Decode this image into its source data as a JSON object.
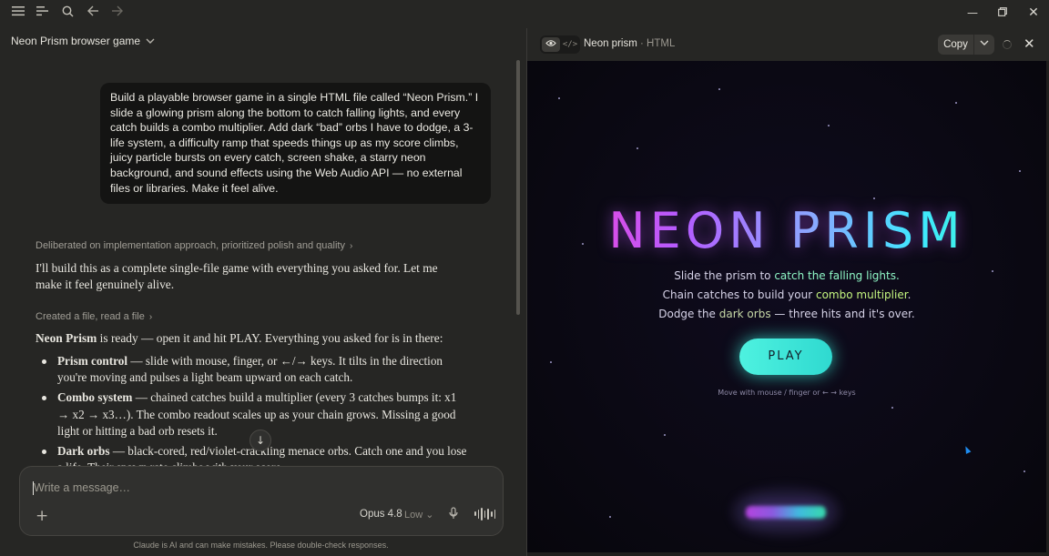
{
  "app": {
    "conversation_title": "Neon Prism browser game",
    "toolbar_icons": [
      "menu-icon",
      "sidebar-icon",
      "search-icon",
      "back-arrow-icon",
      "forward-arrow-icon"
    ]
  },
  "chat": {
    "user_message": "Build a playable browser game in a single HTML file called “Neon Prism.” I slide a glowing prism along the bottom to catch falling lights, and every catch builds a combo multiplier. Add dark “bad” orbs I have to dodge, a 3-life system, a difficulty ramp that speeds things up as my score climbs, juicy particle bursts on every catch, screen shake, a starry neon background, and sound effects using the Web Audio API — no external files or libraries. Make it feel alive.",
    "thinking_summary": "Deliberated on implementation approach, prioritized polish and quality",
    "intro": "I'll build this as a complete single-file game with everything you asked for. Let me make it feel genuinely alive.",
    "tool_summary": "Created a file, read a file",
    "ready_bold": "Neon Prism",
    "ready_rest": " is ready — open it and hit PLAY. Everything you asked for is in there:",
    "bullets": [
      {
        "title": "Prism control",
        "text": " — slide with mouse, finger, or ←/→ keys. It tilts in the direction you're moving and pulses a light beam upward on each catch."
      },
      {
        "title": "Combo system",
        "text": " — chained catches build a multiplier (every 3 catches bumps it: x1 → x2 → x3…). The combo readout scales up as your chain grows. Missing a good light or hitting a bad orb resets it."
      },
      {
        "title": "Dark orbs",
        "text": " — black-cored, red/violet-crackling menace orbs. Catch one and you lose a life. Their spawn rate climbs with your score."
      }
    ]
  },
  "composer": {
    "placeholder": "Write a message…",
    "model": "Opus 4.8",
    "effort": "Low",
    "disclaimer": "Claude is AI and can make mistakes. Please double-check responses."
  },
  "artifact": {
    "title": "Neon prism",
    "type_label": "· HTML",
    "copy_label": "Copy",
    "game": {
      "logo": "NEON PRISM",
      "line1_pre": "Slide the prism to ",
      "line1_hl": "catch the falling lights.",
      "line2_pre": "Chain catches to build your ",
      "line2_hl": "combo multiplier",
      "line2_post": ".",
      "line3_pre": "Dodge the ",
      "line3_hl": "dark orbs",
      "line3_post": " — three hits and it's over.",
      "play_label": "PLAY",
      "hint": "Move with mouse / finger or ← → keys"
    }
  },
  "colors": {
    "accent_cyan": "#4ef2e0",
    "logo_magenta": "#ff3fd0",
    "logo_teal": "#3dfcc2"
  }
}
